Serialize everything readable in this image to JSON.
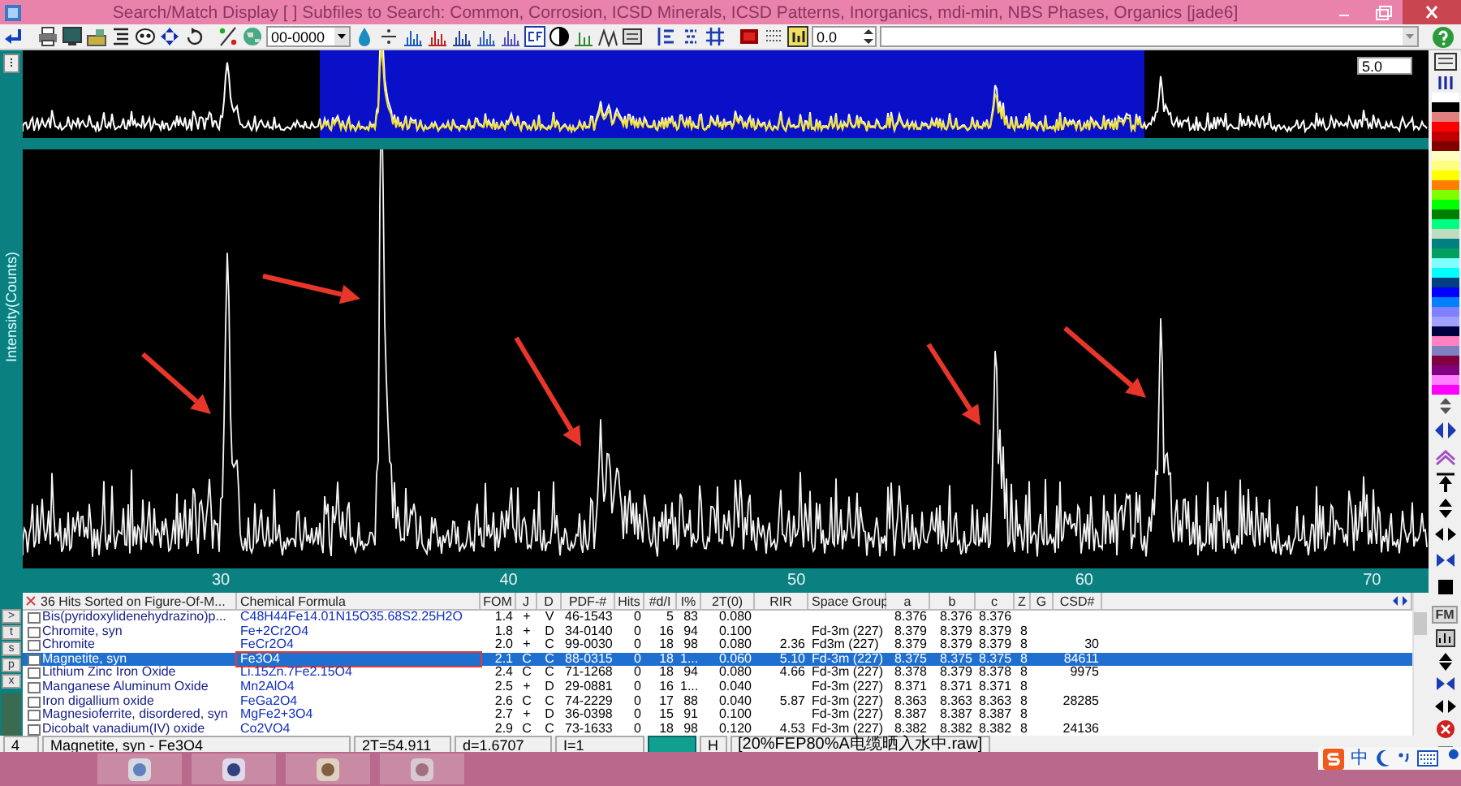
{
  "window": {
    "title": "Search/Match Display [ ] Subfiles to Search: Common, Corrosion, ICSD Minerals, ICSD Patterns, Inorganics, mdi-min, NBS Phases, Organics [jade6]"
  },
  "toolbar": {
    "pdf_field": "00-0000",
    "offset_field": "0.0"
  },
  "overview": {
    "range_field": "5.0"
  },
  "plot": {
    "ylabel": "Intensity(Counts)",
    "x_labels": [
      "30",
      "40",
      "50",
      "60",
      "70"
    ]
  },
  "table": {
    "columns": [
      "36 Hits Sorted on Figure-Of-M...",
      "Chemical Formula",
      "FOM",
      "J",
      "D",
      "PDF-#",
      "Hits",
      "#d/I",
      "I%",
      "2T(0)",
      "RIR",
      "Space Group",
      "a",
      "b",
      "c",
      "Z",
      "G",
      "CSD#"
    ],
    "rows": [
      {
        "checked": false,
        "selected": false,
        "boxed": false,
        "cells": [
          "Bis(pyridoxylidenehydrazino)p...",
          "C48H44Fe14.01N15O35.68S2.25H2O",
          "1.4",
          "+",
          "V",
          "46-1543",
          "0",
          "5",
          "83",
          "0.080",
          null,
          null,
          "8.376",
          "8.376",
          "8.376",
          null,
          null,
          null
        ]
      },
      {
        "checked": false,
        "selected": false,
        "boxed": false,
        "cells": [
          "Chromite, syn",
          "Fe+2Cr2O4",
          "1.8",
          "+",
          "D",
          "34-0140",
          "0",
          "16",
          "94",
          "0.100",
          null,
          "Fd-3m (227)",
          "8.379",
          "8.379",
          "8.379",
          "8",
          null,
          null
        ]
      },
      {
        "checked": false,
        "selected": false,
        "boxed": false,
        "cells": [
          "Chromite",
          "FeCr2O4",
          "2.0",
          "+",
          "C",
          "99-0030",
          "0",
          "18",
          "98",
          "0.080",
          "2.36",
          "Fd3m (227)",
          "8.379",
          "8.379",
          "8.379",
          "8",
          null,
          "30"
        ]
      },
      {
        "checked": false,
        "selected": true,
        "boxed": true,
        "cells": [
          "Magnetite, syn",
          "Fe3O4",
          "2.1",
          "C",
          "C",
          "88-0315",
          "0",
          "18",
          "1...",
          "0.060",
          "5.10",
          "Fd-3m (227)",
          "8.375",
          "8.375",
          "8.375",
          "8",
          null,
          "84611"
        ]
      },
      {
        "checked": false,
        "selected": false,
        "boxed": false,
        "cells": [
          "Lithium Zinc Iron Oxide",
          "Li.15Zn.7Fe2.15O4",
          "2.4",
          "C",
          "C",
          "71-1268",
          "0",
          "18",
          "94",
          "0.080",
          "4.66",
          "Fd-3m (227)",
          "8.378",
          "8.379",
          "8.378",
          "8",
          null,
          "9975"
        ]
      },
      {
        "checked": false,
        "selected": false,
        "boxed": false,
        "cells": [
          "Manganese Aluminum Oxide",
          "Mn2AlO4",
          "2.5",
          "+",
          "D",
          "29-0881",
          "0",
          "16",
          "1...",
          "0.040",
          null,
          "Fd-3m (227)",
          "8.371",
          "8.371",
          "8.371",
          "8",
          null,
          null
        ]
      },
      {
        "checked": false,
        "selected": false,
        "boxed": false,
        "cells": [
          "Iron digallium oxide",
          "FeGa2O4",
          "2.6",
          "C",
          "C",
          "74-2229",
          "0",
          "17",
          "88",
          "0.040",
          "5.87",
          "Fd-3m (227)",
          "8.363",
          "8.363",
          "8.363",
          "8",
          null,
          "28285"
        ]
      },
      {
        "checked": false,
        "selected": false,
        "boxed": false,
        "cells": [
          "Magnesioferrite, disordered, syn",
          "MgFe2+3O4",
          "2.7",
          "+",
          "D",
          "36-0398",
          "0",
          "15",
          "91",
          "0.100",
          null,
          "Fd-3m (227)",
          "8.387",
          "8.387",
          "8.387",
          "8",
          null,
          null
        ]
      },
      {
        "checked": false,
        "selected": false,
        "boxed": false,
        "cells": [
          "Dicobalt vanadium(IV) oxide",
          "Co2VO4",
          "2.9",
          "C",
          "C",
          "73-1633",
          "0",
          "18",
          "98",
          "0.120",
          "4.53",
          "Fd-3m (227)",
          "8.382",
          "8.382",
          "8.382",
          "8",
          null,
          "24136"
        ]
      }
    ]
  },
  "table_side_buttons": [
    ">",
    "t",
    "s",
    "p",
    "x"
  ],
  "status_bar": {
    "index": "4",
    "phase": "Magnetite, syn - Fe3O4",
    "two_theta": "2T=54.911",
    "d_spacing": "d=1.6707",
    "intensity": "I=1",
    "mode": "H",
    "file": "[20%FEP80%A电缆晒入水中.raw]"
  },
  "right_toolbar": {
    "label": "FM"
  },
  "palette": [
    {
      "color": "#ffffff"
    },
    {
      "color": "#000000"
    },
    {
      "color": "#e08080"
    },
    {
      "color": "#ff0000"
    },
    {
      "color": "#c00000"
    },
    {
      "color": "#800000"
    },
    {
      "color": "#ffffc0"
    },
    {
      "color": "#ffff80"
    },
    {
      "color": "#ffff00"
    },
    {
      "color": "#ff8000"
    },
    {
      "color": "#80ff00"
    },
    {
      "color": "#00ff00"
    },
    {
      "color": "#008000"
    },
    {
      "color": "#00ff80"
    },
    {
      "color": "#c0dcc0"
    },
    {
      "color": "#008080"
    },
    {
      "color": "#00a060"
    },
    {
      "color": "#80ffff"
    },
    {
      "color": "#00ffff"
    },
    {
      "color": "#004080"
    },
    {
      "color": "#0000ff"
    },
    {
      "color": "#0080ff"
    },
    {
      "color": "#8080ff"
    },
    {
      "color": "#a0a0ff"
    },
    {
      "color": "#000040"
    },
    {
      "color": "#ff80c0"
    },
    {
      "color": "#8080c0"
    },
    {
      "color": "#800040"
    },
    {
      "color": "#800080"
    },
    {
      "color": "#ff80ff"
    },
    {
      "color": "#ff00ff"
    }
  ],
  "ime": {
    "mode": "中"
  }
}
